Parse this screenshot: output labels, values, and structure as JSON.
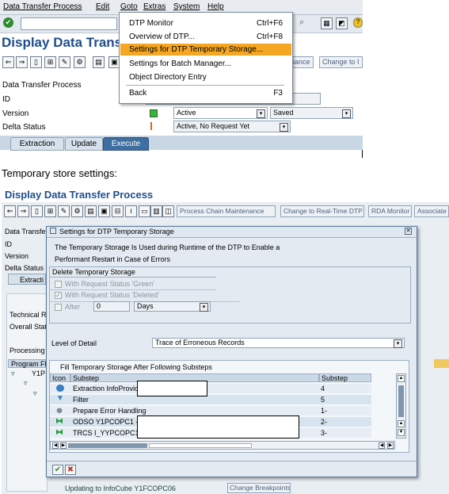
{
  "menubar": {
    "items": [
      "Data Transfer Process",
      "Edit",
      "Goto",
      "Extras",
      "System",
      "Help"
    ]
  },
  "top": {
    "title": "Display Data Transfe",
    "right_buttons": [
      "nance",
      "Change to I"
    ],
    "labels": [
      "Data Transfer Process",
      "ID",
      "Version",
      "Delta Status"
    ],
    "version_value": "Active",
    "version_state": "Saved",
    "delta_value": "Active, No Request Yet",
    "tabs": [
      "Extraction",
      "Update",
      "Execute"
    ]
  },
  "goto_menu": {
    "items": [
      {
        "label": "DTP Monitor",
        "shortcut": "Ctrl+F6"
      },
      {
        "label": "Overview of DTP...",
        "shortcut": "Ctrl+F8"
      },
      {
        "label": "Settings for DTP Temporary Storage...",
        "shortcut": ""
      },
      {
        "label": "Settings for Batch Manager...",
        "shortcut": ""
      },
      {
        "label": "Object Directory Entry",
        "shortcut": ""
      },
      {
        "label": "Back",
        "shortcut": "F3"
      }
    ]
  },
  "caption": "Temporary store settings:",
  "second": {
    "title": "Display Data Transfer Process",
    "toolbar_buttons": [
      "Process Chain Maintenance",
      "Change to Real-Time DTP",
      "RDA Monitor",
      "Associate"
    ],
    "labels": [
      "Data Transfer",
      "ID",
      "Version",
      "Delta Status",
      "Extracti",
      "Technical R",
      "Overall Statu",
      "Processing",
      "Program Fl"
    ],
    "tree_items": [
      "Y1P"
    ],
    "bottom_text": "Updating to InfoCube Y1FCOPC06",
    "bottom_button": "Change Breakpoints"
  },
  "dialog": {
    "title": "Settings for DTP Temporary Storage",
    "description_line1": "The Temporary Storage Is Used during Runtime of the DTP to Enable a",
    "description_line2": "Performant Restart in Case of Errors",
    "group_title": "Delete Temporary Storage",
    "option_green": "With Request Status 'Green'",
    "option_deleted": "With Request Status 'Deleted'",
    "option_after": "After",
    "after_value": "0",
    "after_unit": "Days",
    "level_label": "Level of Detail",
    "level_value": "Trace of Erroneous Records",
    "table_title": "Fill Temporary Storage After Following Substeps",
    "columns": [
      "Icon",
      "Substep",
      "Substep"
    ],
    "rows": [
      {
        "substep": "Extraction InfoProvide",
        "value": "4"
      },
      {
        "substep": "Filter",
        "value": "5"
      },
      {
        "substep": "Prepare Error Handling",
        "value": "1-"
      },
      {
        "substep": "ODSO Y1PCOPC1 ->",
        "value": "2-"
      },
      {
        "substep": "TRCS I_YYPCOPC1 -",
        "value": "3-"
      }
    ],
    "ok_label": "✔",
    "cancel_label": "✖"
  },
  "colors": {
    "title_blue": "#1f4e8c",
    "menu_highlight": "#f5a623",
    "ok_green": "#2e8b2e",
    "cancel_red": "#c0392b"
  }
}
